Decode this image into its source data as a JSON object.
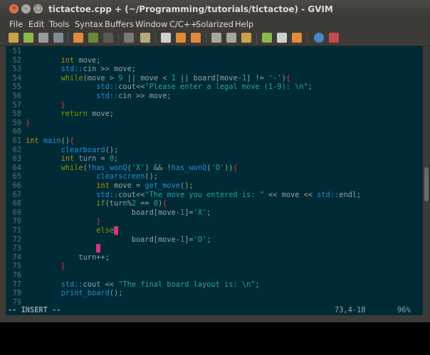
{
  "window": {
    "title": "tictactoe.cpp + (~/Programming/tutorials/tictactoe) - GVIM",
    "buttons": {
      "close": "×",
      "minimize": "–",
      "maximize": "□"
    }
  },
  "menu": {
    "items": [
      "File",
      "Edit",
      "Tools",
      "Syntax",
      "Buffers",
      "Window",
      "C/C++",
      "Solarized",
      "Help"
    ]
  },
  "toolbar": {
    "icons": [
      "open-icon",
      "save-icon",
      "save-all-icon",
      "print-icon",
      "undo-icon",
      "redo-icon",
      "cut-icon",
      "copy-icon",
      "paste-icon",
      "find-replace-icon",
      "find-next-icon",
      "find-prev-icon",
      "load-session-icon",
      "save-session-icon",
      "run-script-icon",
      "make-icon",
      "ctags-icon",
      "jump-tag-icon",
      "help-icon",
      "find-help-icon"
    ]
  },
  "editor": {
    "lines": [
      {
        "n": "51",
        "t": ""
      },
      {
        "n": "52",
        "t": "        int move;"
      },
      {
        "n": "53",
        "t": "        std::cin >> move;"
      },
      {
        "n": "54",
        "t": "        while(move > 9 || move < 1 || board[move-1] != '-'){"
      },
      {
        "n": "55",
        "t": "                std::cout<<\"Please enter a legal move (1-9): \\n\";"
      },
      {
        "n": "56",
        "t": "                std::cin >> move;"
      },
      {
        "n": "57",
        "t": "        }"
      },
      {
        "n": "58",
        "t": "        return move;"
      },
      {
        "n": "59",
        "t": "}"
      },
      {
        "n": "60",
        "t": ""
      },
      {
        "n": "61",
        "t": "int main(){"
      },
      {
        "n": "62",
        "t": "        clearboard();"
      },
      {
        "n": "63",
        "t": "        int turn = 0;"
      },
      {
        "n": "64",
        "t": "        while(!has_wonQ('X') && !has_wonQ('O')){"
      },
      {
        "n": "65",
        "t": "                clearscreen();"
      },
      {
        "n": "66",
        "t": "                int move = get_move();"
      },
      {
        "n": "67",
        "t": "                std::cout<<\"The move you entered is: \" << move << std::endl;"
      },
      {
        "n": "68",
        "t": "                if(turn%2 == 0){"
      },
      {
        "n": "69",
        "t": "                        board[move-1]='X';"
      },
      {
        "n": "70",
        "t": "                }"
      },
      {
        "n": "71",
        "t": "                else"
      },
      {
        "n": "72",
        "t": "                        board[move-1]='O';"
      },
      {
        "n": "73",
        "t": "                "
      },
      {
        "n": "74",
        "t": "            turn++;"
      },
      {
        "n": "75",
        "t": "        }"
      },
      {
        "n": "76",
        "t": ""
      },
      {
        "n": "77",
        "t": "        std::cout << \"The final board layout is: \\n\";"
      },
      {
        "n": "78",
        "t": "        print_board();"
      },
      {
        "n": "79",
        "t": ""
      }
    ]
  },
  "status": {
    "mode": "-- INSERT --",
    "position": "73,4-18",
    "percent": "96%"
  },
  "colors": {
    "background": "#002b36",
    "keyword": "#859900",
    "type": "#b58900",
    "namespace": "#268bd2",
    "string": "#2aa198",
    "bracket": "#dc322f",
    "cursor": "#d33682"
  }
}
